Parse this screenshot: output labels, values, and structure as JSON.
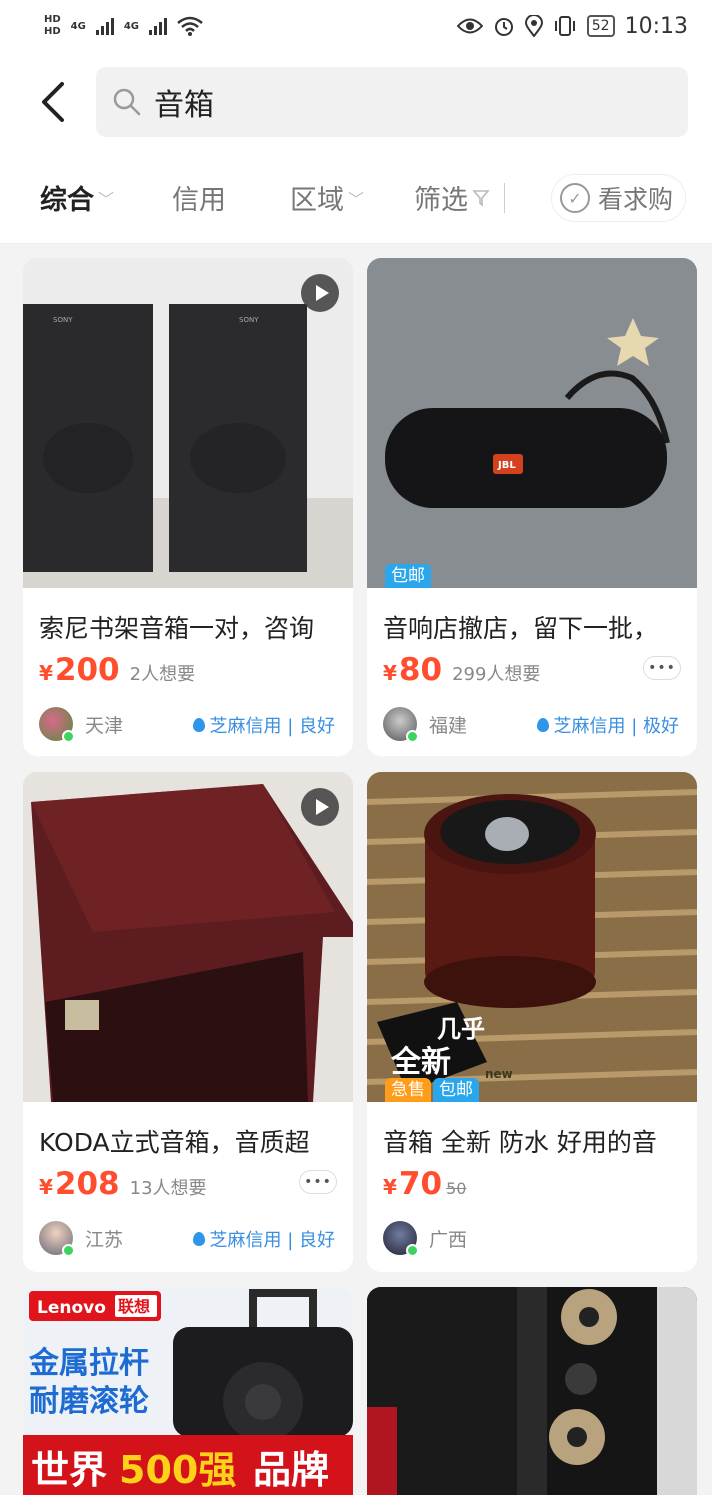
{
  "status_bar": {
    "hd1": "HD",
    "hd2": "HD",
    "net1": "4G",
    "net2": "4G",
    "battery": "52",
    "time": "10:13"
  },
  "search": {
    "query": "音箱"
  },
  "filters": {
    "items": [
      {
        "label": "综合",
        "active": true
      },
      {
        "label": "信用"
      },
      {
        "label": "区域"
      },
      {
        "label": "筛选"
      }
    ],
    "want_to_buy": "看求购"
  },
  "listings": [
    {
      "title": "索尼书架音箱一对，咨询",
      "currency": "¥",
      "price": "200",
      "wants": "2人想要",
      "location": "天津",
      "credit": "芝麻信用 | 良好",
      "has_video": true
    },
    {
      "title": "音响店撤店，留下一批，",
      "currency": "¥",
      "price": "80",
      "wants": "299人想要",
      "location": "福建",
      "credit": "芝麻信用 | 极好",
      "tags": [
        "包邮"
      ],
      "more": "•••"
    },
    {
      "title": "KODA立式音箱，音质超",
      "currency": "¥",
      "price": "208",
      "wants": "13人想要",
      "location": "江苏",
      "credit": "芝麻信用 | 良好",
      "has_video": true,
      "more": "•••"
    },
    {
      "title": "音箱 全新 防水 好用的音",
      "currency": "¥",
      "price": "70",
      "original_price": "50",
      "location": "广西",
      "tags": [
        "急售",
        "包邮"
      ]
    },
    {
      "ad_brand": "Lenovo",
      "ad_brand_cn": "联想",
      "ad_line1": "金属拉杆",
      "ad_line2": "耐磨滚轮",
      "ad_banner_a": "世界",
      "ad_banner_b": "500强",
      "ad_banner_c": "品牌"
    },
    {}
  ],
  "photo_text": {
    "sony": "SONY",
    "jbl": "JBL",
    "sticker1": "几乎",
    "sticker2": "全新",
    "sticker3": "new"
  },
  "colors": {
    "price": "#ff4d2d",
    "tag_blue": "#29a6ec",
    "tag_orange": "#ff9c1a",
    "credit_blue": "#3a8fe0"
  }
}
